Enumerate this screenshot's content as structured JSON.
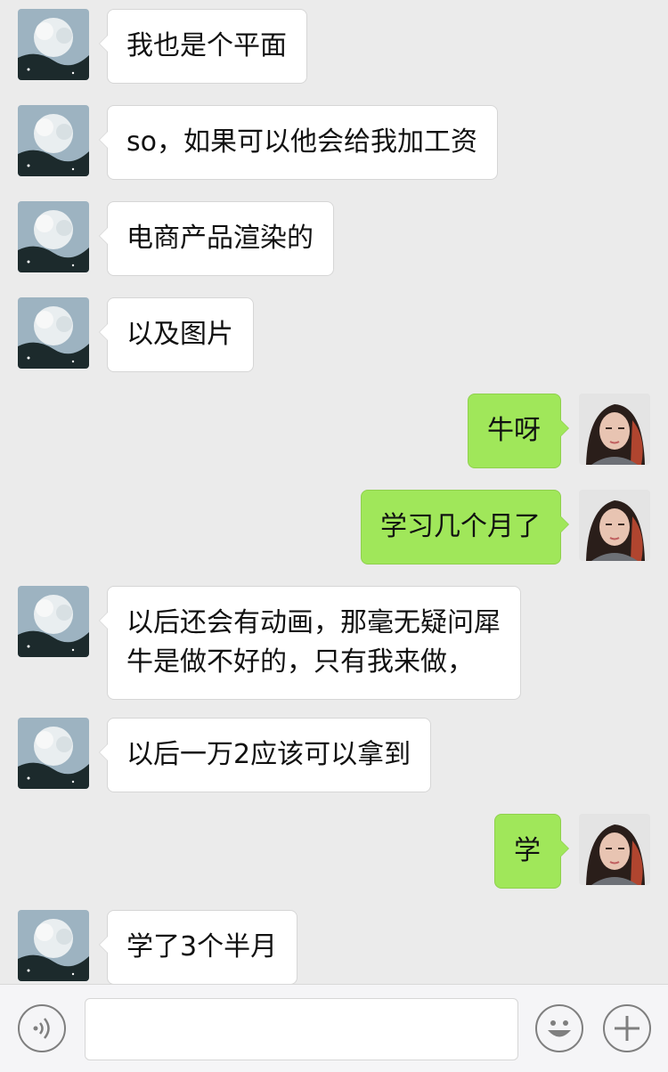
{
  "messages": [
    {
      "side": "left",
      "text": "我也是个平面"
    },
    {
      "side": "left",
      "text": "so，如果可以他会给我加工资"
    },
    {
      "side": "left",
      "text": "电商产品渲染的"
    },
    {
      "side": "left",
      "text": "以及图片"
    },
    {
      "side": "right",
      "text": "牛呀"
    },
    {
      "side": "right",
      "text": "学习几个月了"
    },
    {
      "side": "left",
      "text": "以后还会有动画，那毫无疑问犀\n牛是做不好的，只有我来做，"
    },
    {
      "side": "left",
      "text": "以后一万2应该可以拿到"
    },
    {
      "side": "right",
      "text": "学"
    },
    {
      "side": "left",
      "text": "学了3个半月"
    }
  ],
  "input_bar": {
    "voice_icon": "voice-icon",
    "emoji_icon": "emoji-icon",
    "plus_icon": "plus-icon",
    "text_value": "",
    "placeholder": ""
  },
  "colors": {
    "background": "#ebebeb",
    "sent_bubble": "#a0e75a",
    "received_bubble": "#ffffff"
  }
}
